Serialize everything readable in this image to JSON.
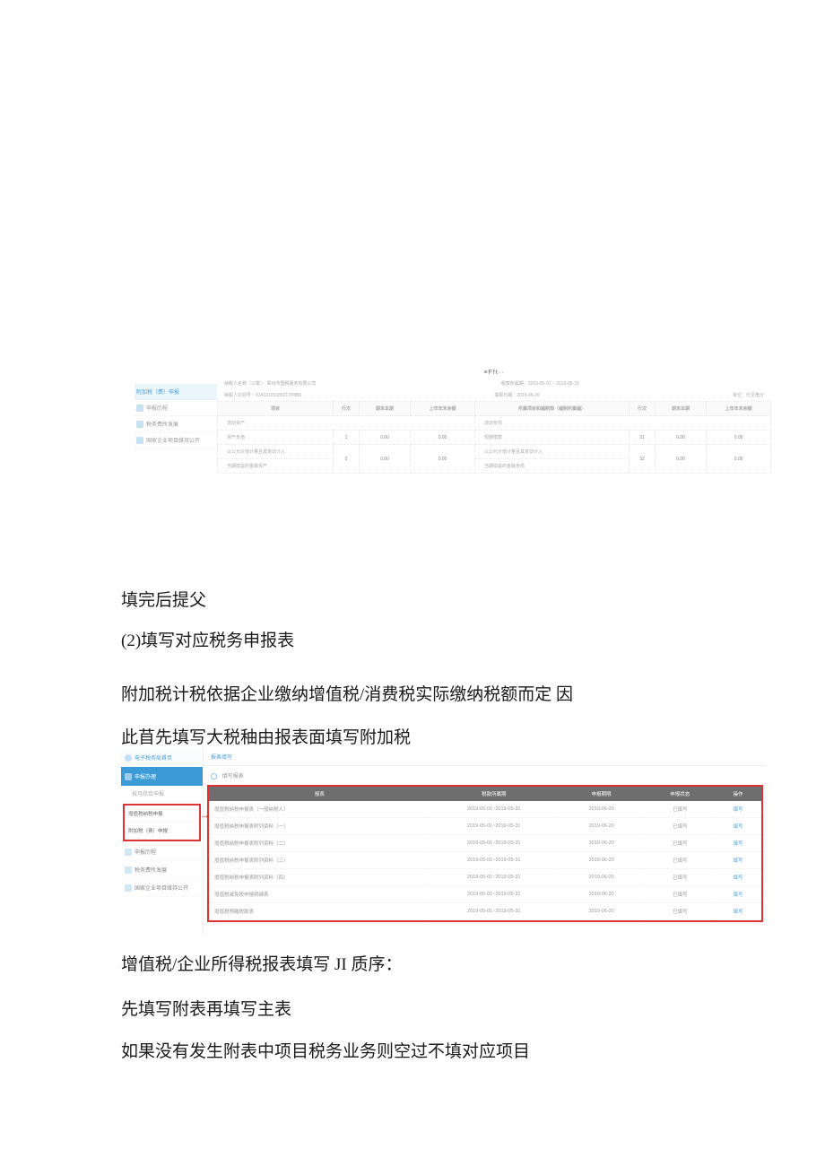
{
  "screenshot1": {
    "sidebar": [
      {
        "label": "附加税（费）申报"
      },
      {
        "label": "申报历程"
      },
      {
        "label": "税务费所发展"
      },
      {
        "label": "国家企业项目维持公开"
      }
    ],
    "header": "≡Fft··",
    "taxpayer_name_label": "纳税人名称（公章）：郑州市国税服务有限公司",
    "taxpayer_id_label": "纳税人识别号：91410105335217P8B0",
    "period_label": "税款所属期：2019-05-01 ~ 2019-05-31",
    "fill_date_label": "填报日期：2019-06-20",
    "unit_label": "单位：元至角分",
    "columns": {
      "item": "项目",
      "line": "行次",
      "current": "期末本期",
      "ytd": "上年年末余额",
      "item2": "所属项目和编制规（编制所属编）",
      "line2": "行次",
      "current2": "期末本期",
      "ytd2": "上年年末余额"
    },
    "section_left": "流动资产",
    "section_right": "流动负债",
    "rows": [
      {
        "l": "资产负值",
        "ln": "1",
        "c": "0.00",
        "y": "0.00",
        "r": "短期借款",
        "rn": "31",
        "rc": "0.00",
        "ry": "0.00"
      },
      {
        "l": "以公允价值计量且其变动计入",
        "ln": "2",
        "c": "0.00",
        "y": "0.00",
        "r": "以公允价值计量且其变动计入",
        "rn": "32",
        "rc": "0.00",
        "ry": "0.00"
      },
      {
        "l": "当期损益的金融资产",
        "ln": "",
        "c": "",
        "y": "",
        "r": "当期损益的金融负债",
        "rn": "",
        "rc": "",
        "ry": ""
      }
    ]
  },
  "body": {
    "p1": "填完后提父",
    "p2": "(2)填写对应税务申报表",
    "p3": "附加税计税依据企业缴纳增值税/消费税实际缴纳税额而定  因",
    "p4": "此苜先填写大税秞由报表面填写附加税",
    "p5": "增值税/企业所得税报表填写 JI 质序：",
    "p6": "先填写附表再填写主表",
    "p7": "如果没有发生附表中项目税务业务则空过不填对应项目"
  },
  "screenshot2": {
    "top_crumb": "电子税务局首页",
    "sidebar_active": "申报办理",
    "sidebar_sub": "按月综合申报",
    "redbox_items": [
      "增值税纳税申报",
      "附加税（费）申报"
    ],
    "sidebar_items": [
      "申报历程",
      "税务费所发展",
      "国家企业项目维持公开"
    ],
    "tab_label": "报表填写",
    "fill_hint": "填写报表",
    "columns": {
      "name": "报表",
      "period": "税款所属期",
      "due": "申报期限",
      "status": "申报状态",
      "action": "操作"
    },
    "rows": [
      {
        "name": "增值税纳税申报表（一般纳税人）",
        "period": "2019-05-01~2019-05-31",
        "due": "2019-06-20",
        "status": "已填写",
        "action": "填写"
      },
      {
        "name": "增值税纳税申报表附列资料（一）",
        "period": "2019-05-01~2019-05-31",
        "due": "2019-06-20",
        "status": "已填写",
        "action": "填写"
      },
      {
        "name": "增值税纳税申报表附列资料（二）",
        "period": "2019-05-01~2019-05-31",
        "due": "2019-06-20",
        "status": "已填写",
        "action": "填写"
      },
      {
        "name": "增值税纳税申报表附列资料（三）",
        "period": "2019-05-01~2019-05-31",
        "due": "2019-06-20",
        "status": "已填写",
        "action": "填写"
      },
      {
        "name": "增值税纳税申报表附列资料（四）",
        "period": "2019-05-01~2019-05-31",
        "due": "2019-06-20",
        "status": "已填写",
        "action": "填写"
      },
      {
        "name": "增值税减免税申报明细表",
        "period": "2019-05-01~2019-05-31",
        "due": "2019-06-20",
        "status": "已填写",
        "action": "填写"
      },
      {
        "name": "增值税预缴税款表",
        "period": "2019-05-01~2019-05-31",
        "due": "2019-06-20",
        "status": "已填写",
        "action": "填写"
      }
    ]
  }
}
